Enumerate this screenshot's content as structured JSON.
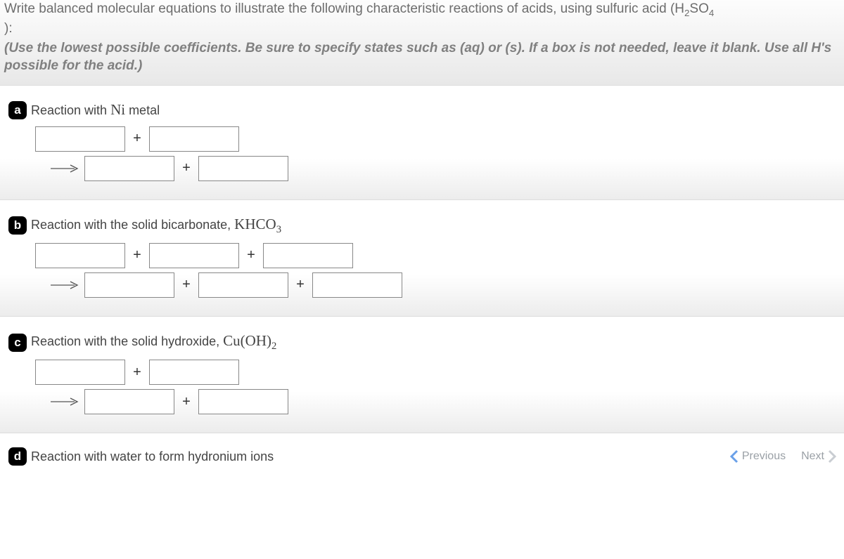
{
  "question": {
    "prompt_line1": "Write balanced molecular equations to illustrate the following characteristic reactions of acids, using sulfuric acid (H",
    "prompt_sub1": "2",
    "prompt_mid": "SO",
    "prompt_sub2": "4",
    "prompt_end": "):",
    "instructions": "(Use the lowest possible coefficients. Be sure to specify states such as (aq) or (s). If a box is not needed, leave it blank. Use all H's possible for the acid.)"
  },
  "parts": {
    "a": {
      "letter": "a",
      "title_prefix": "Reaction with ",
      "formula": "Ni",
      "title_suffix": " metal",
      "row1_boxes": 2,
      "row2_boxes": 2
    },
    "b": {
      "letter": "b",
      "title_prefix": "Reaction with the solid bicarbonate, ",
      "formula": "KHCO",
      "formula_sub": "3",
      "title_suffix": "",
      "row1_boxes": 3,
      "row2_boxes": 3
    },
    "c": {
      "letter": "c",
      "title_prefix": "Reaction with the solid hydroxide, ",
      "formula": "Cu(OH)",
      "formula_sub": "2",
      "title_suffix": "",
      "row1_boxes": 2,
      "row2_boxes": 2
    },
    "d": {
      "letter": "d",
      "title": "Reaction with water to form hydronium ions"
    }
  },
  "symbols": {
    "plus": "+"
  },
  "nav": {
    "previous": "Previous",
    "next": "Next"
  }
}
